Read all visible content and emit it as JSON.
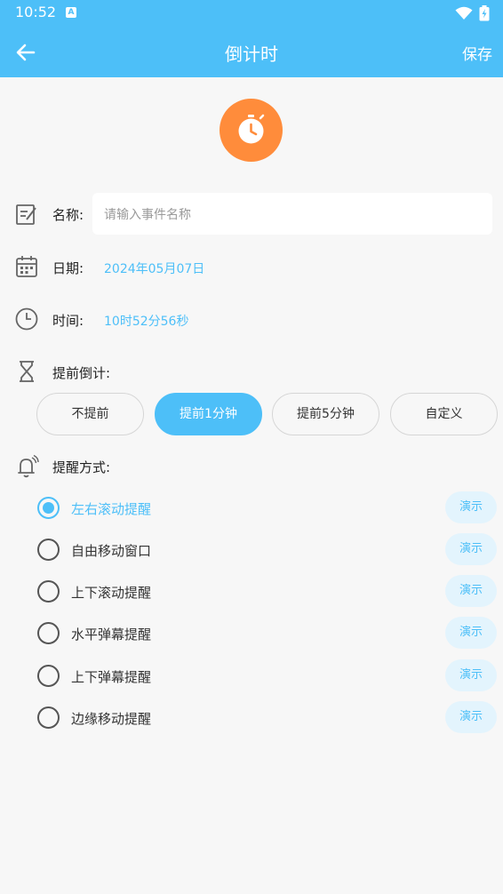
{
  "status_bar": {
    "time": "10:52",
    "notification_icon": "A"
  },
  "app_bar": {
    "title": "倒计时",
    "save_label": "保存"
  },
  "form": {
    "name": {
      "label": "名称:",
      "placeholder": "请输入事件名称",
      "value": ""
    },
    "date": {
      "label": "日期:",
      "value": "2024年05月07日"
    },
    "time": {
      "label": "时间:",
      "value": "10时52分56秒"
    },
    "advance": {
      "label": "提前倒计:",
      "options": [
        "不提前",
        "提前1分钟",
        "提前5分钟",
        "自定义"
      ],
      "selected": "提前1分钟"
    },
    "reminder": {
      "label": "提醒方式:",
      "demo_label": "演示",
      "selected": "左右滚动提醒",
      "options": [
        "左右滚动提醒",
        "自由移动窗口",
        "上下滚动提醒",
        "水平弹幕提醒",
        "上下弹幕提醒",
        "边缘移动提醒"
      ]
    }
  },
  "colors": {
    "accent": "#4dbff8",
    "clock_badge": "#ff8c3b",
    "background": "#f7f7f7"
  }
}
